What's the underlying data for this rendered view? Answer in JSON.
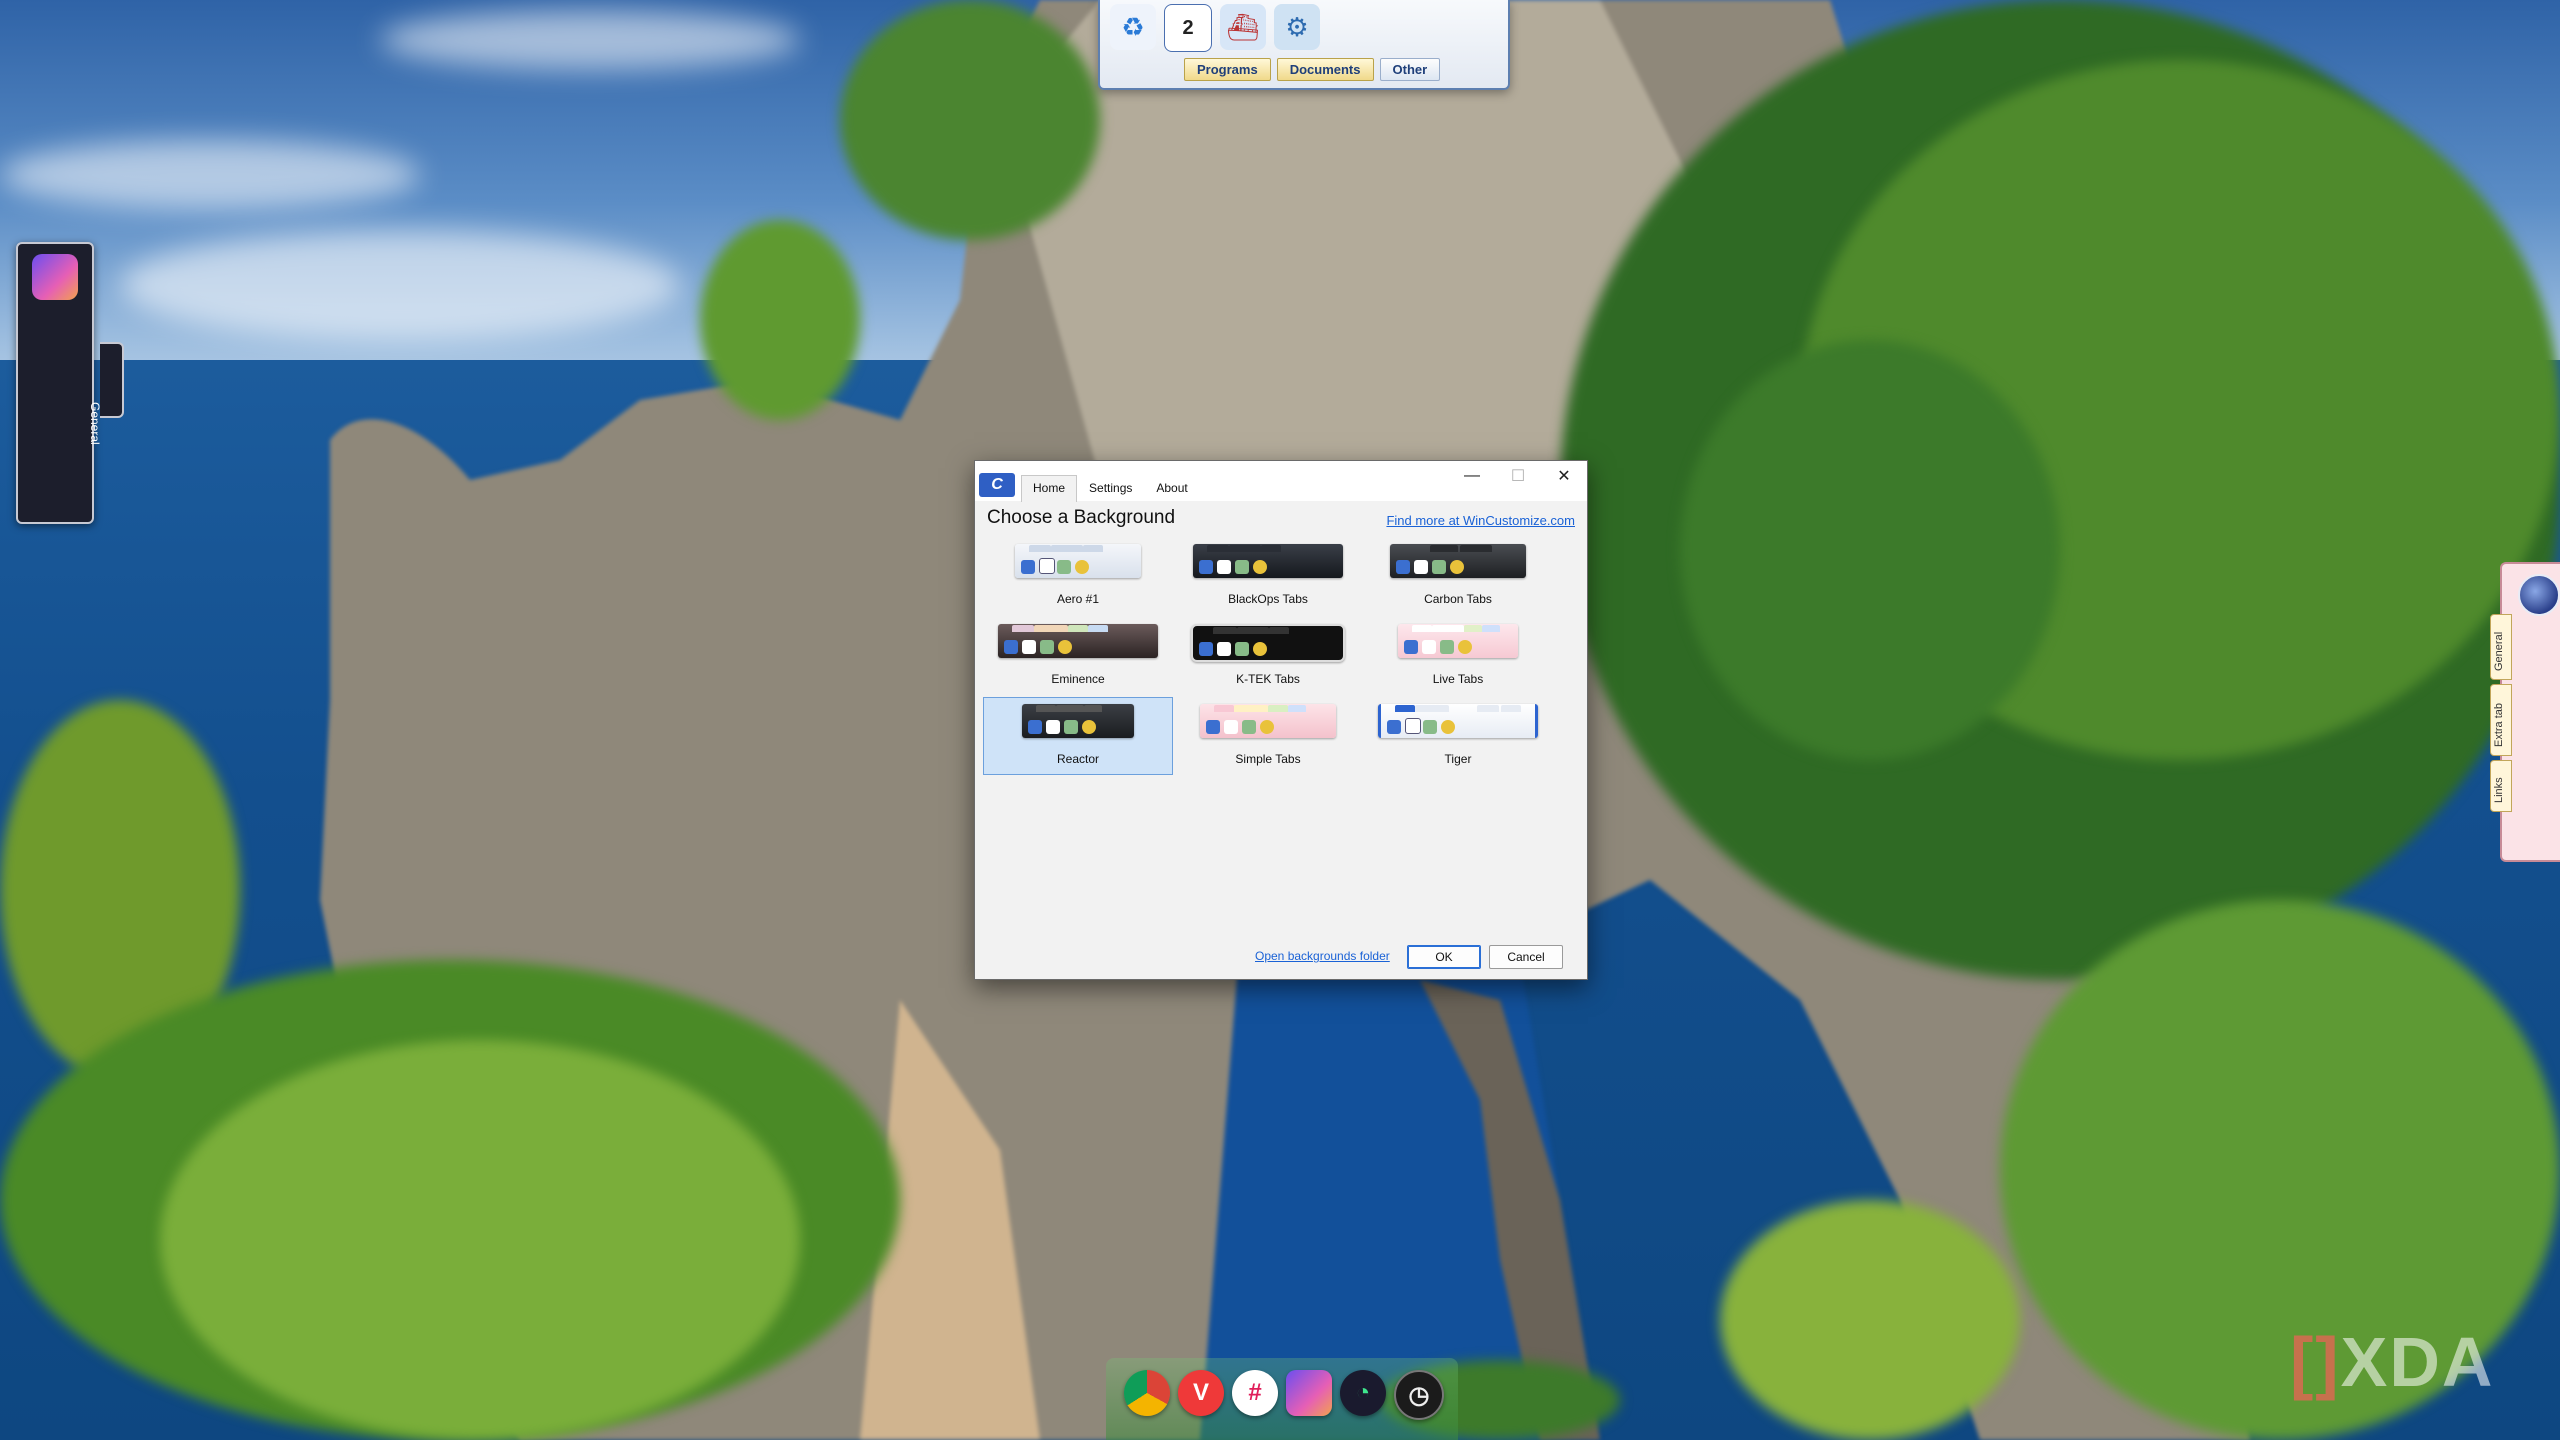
{
  "top_dock": {
    "icons": [
      "recycle-bin-icon",
      "calendar-icon",
      "ship-icon",
      "gear-icon"
    ],
    "calendar_day": "2",
    "tabs": [
      {
        "label": "Programs"
      },
      {
        "label": "Documents"
      },
      {
        "label": "Other"
      }
    ]
  },
  "left_dock": {
    "app_icon": "copilot-icon",
    "tab_label": "General"
  },
  "right_dock": {
    "app_icon": "globe-orb-icon",
    "tabs": [
      {
        "label": "General"
      },
      {
        "label": "Extra tab"
      },
      {
        "label": "Links"
      }
    ]
  },
  "bottom_dock": {
    "icons": [
      "chrome-icon",
      "vivaldi-icon",
      "slack-icon",
      "copilot-icon",
      "spotify-like-icon",
      "clock-icon"
    ]
  },
  "watermark": {
    "bracket": "[]",
    "text": "XDA"
  },
  "dialog": {
    "tabs": [
      {
        "label": "Home"
      },
      {
        "label": "Settings"
      },
      {
        "label": "About"
      }
    ],
    "heading": "Choose a Background",
    "find_more_link": "Find more at WinCustomize.com",
    "backgrounds": [
      {
        "name": "Aero #1"
      },
      {
        "name": "BlackOps Tabs"
      },
      {
        "name": "Carbon Tabs"
      },
      {
        "name": "Eminence"
      },
      {
        "name": "K-TEK Tabs"
      },
      {
        "name": "Live Tabs"
      },
      {
        "name": "Reactor"
      },
      {
        "name": "Simple Tabs"
      },
      {
        "name": "Tiger"
      }
    ],
    "selected": "Reactor",
    "open_folder_link": "Open backgrounds folder",
    "ok_label": "OK",
    "cancel_label": "Cancel"
  },
  "colors": {
    "accent": "#1a62d6",
    "selection": "#cfe3f8"
  }
}
